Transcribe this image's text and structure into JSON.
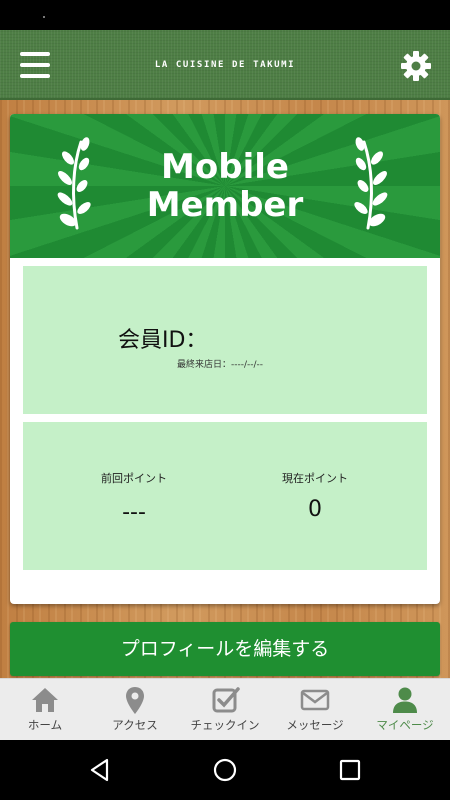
{
  "app_bar": {
    "title": "LA CUISINE DE TAKUMI",
    "menu_icon": "hamburger-icon",
    "settings_icon": "gear-icon",
    "color": "#4e7e45"
  },
  "banner": {
    "line1": "Mobile",
    "line2": "Member",
    "color": "#2a9a3d"
  },
  "member": {
    "id_label": "会員ID：",
    "last_visit": "最終来店日：----/--/--"
  },
  "points": {
    "previous_label": "前回ポイント",
    "previous_value": "---",
    "current_label": "現在ポイント",
    "current_value": "0"
  },
  "edit_profile_label": "プロフィールを編集する",
  "bottom_nav": {
    "items": [
      {
        "label": "ホーム",
        "icon": "home-icon"
      },
      {
        "label": "アクセス",
        "icon": "map-pin-icon"
      },
      {
        "label": "チェックイン",
        "icon": "checkin-icon"
      },
      {
        "label": "メッセージ",
        "icon": "mail-icon"
      },
      {
        "label": "マイページ",
        "icon": "user-icon",
        "active": true
      }
    ],
    "active_color": "#4e8b4a"
  },
  "system_nav": [
    "back-icon",
    "home-circle-icon",
    "recents-icon"
  ]
}
